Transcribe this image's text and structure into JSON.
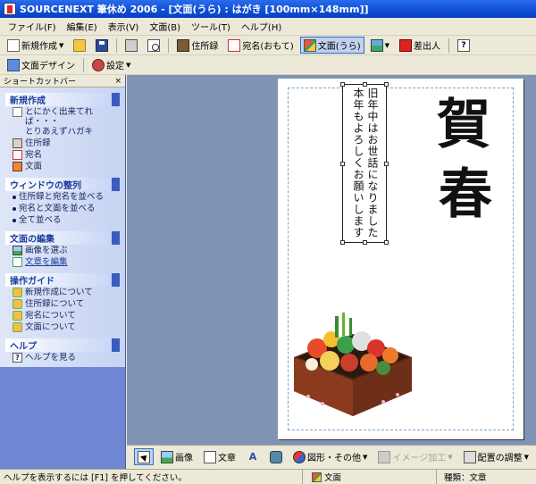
{
  "window": {
    "title": "SOURCENEXT 筆休め 2006 - [文面(うら) : はがき [100mm×148mm]]"
  },
  "menu": [
    "ファイル(F)",
    "編集(E)",
    "表示(V)",
    "文面(B)",
    "ツール(T)",
    "ヘルプ(H)"
  ],
  "toolbar1": {
    "new_label": "新規作成",
    "address_book_label": "住所録",
    "address_front_label": "宛名(おもて)",
    "body_back_label": "文面(うら)",
    "sender_label": "差出人"
  },
  "toolbar2": {
    "design_label": "文面デザイン",
    "settings_label": "設定"
  },
  "sidebar": {
    "header": "ショートカットバー",
    "close": "×",
    "sections": [
      {
        "title": "新規作成",
        "items": [
          "とにかく出来てれば・・・",
          "とりあえずハガキ",
          "住所録",
          "宛名",
          "文面"
        ]
      },
      {
        "title": "ウィンドウの整列",
        "items": [
          "住所録と宛名を並べる",
          "宛名と文面を並べる",
          "全て並べる"
        ]
      },
      {
        "title": "文面の編集",
        "items": [
          "画像を選ぶ",
          "文章を編集"
        ]
      },
      {
        "title": "操作ガイド",
        "items": [
          "新規作成について",
          "住所録について",
          "宛名について",
          "文面について"
        ]
      },
      {
        "title": "ヘルプ",
        "items": [
          "ヘルプを見る"
        ]
      }
    ]
  },
  "card": {
    "greeting_line1": "旧年中はお世話になりました",
    "greeting_line2": "本年もよろしくお願いします",
    "title_char1": "賀",
    "title_char2": "春"
  },
  "bottom_toolbar": {
    "image_label": "画像",
    "text_label": "文章",
    "shape_label": "図形・その他",
    "image_edit_label": "イメージ加工",
    "arrange_label": "配置の調整"
  },
  "status": {
    "hint": "ヘルプを表示するには [F1] を押してください。",
    "mode": "文面",
    "type": "種類：文章"
  }
}
